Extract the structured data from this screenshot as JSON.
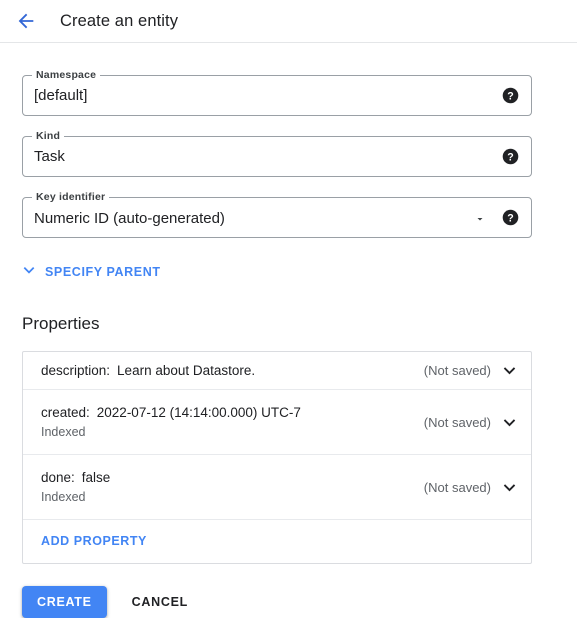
{
  "header": {
    "back_icon": "arrow-left-icon",
    "title": "Create an entity"
  },
  "colors": {
    "accent_blue": "#4285f4",
    "text_primary": "#202124",
    "text_secondary": "#5f6368",
    "border": "#dadce0"
  },
  "form": {
    "namespace": {
      "label": "Namespace",
      "value": "[default]",
      "help_icon": "help-icon"
    },
    "kind": {
      "label": "Kind",
      "value": "Task",
      "help_icon": "help-icon"
    },
    "key_identifier": {
      "label": "Key identifier",
      "value": "Numeric ID (auto-generated)",
      "dropdown_icon": "chevron-down-icon",
      "help_icon": "help-icon",
      "options": [
        "Numeric ID (auto-generated)"
      ]
    }
  },
  "specify_parent": {
    "label": "SPECIFY PARENT",
    "icon": "chevron-down-icon"
  },
  "properties": {
    "title": "Properties",
    "rows": [
      {
        "key": "description:",
        "value": "Learn about Datastore.",
        "sub": "",
        "status": "(Not saved)",
        "expand_icon": "chevron-down-icon"
      },
      {
        "key": "created:",
        "value": "2022-07-12 (14:14:00.000) UTC-7",
        "sub": "Indexed",
        "status": "(Not saved)",
        "expand_icon": "chevron-down-icon"
      },
      {
        "key": "done:",
        "value": "false",
        "sub": "Indexed",
        "status": "(Not saved)",
        "expand_icon": "chevron-down-icon"
      }
    ],
    "add_property_label": "ADD PROPERTY"
  },
  "actions": {
    "create_label": "CREATE",
    "cancel_label": "CANCEL"
  }
}
